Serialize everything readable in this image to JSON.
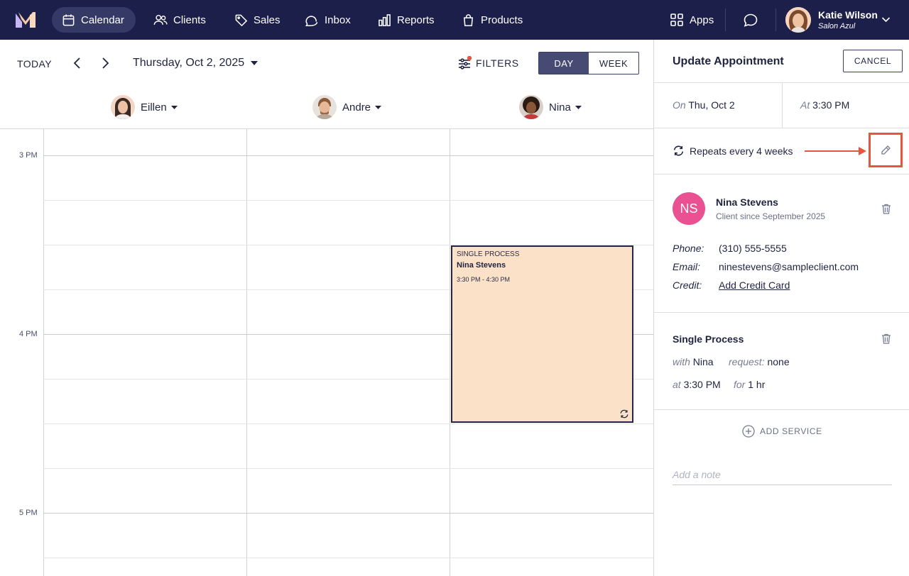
{
  "nav": {
    "items": [
      {
        "label": "Calendar",
        "icon": "calendar-icon",
        "active": true
      },
      {
        "label": "Clients",
        "icon": "clients-icon",
        "active": false
      },
      {
        "label": "Sales",
        "icon": "tag-icon",
        "active": false
      },
      {
        "label": "Inbox",
        "icon": "inbox-icon",
        "active": false
      },
      {
        "label": "Reports",
        "icon": "reports-icon",
        "active": false
      },
      {
        "label": "Products",
        "icon": "bag-icon",
        "active": false
      }
    ],
    "apps_label": "Apps",
    "user": {
      "name": "Katie Wilson",
      "salon": "Salon Azul"
    }
  },
  "toolbar": {
    "today_label": "TODAY",
    "date_label": "Thursday, Oct 2, 2025",
    "filters_label": "FILTERS",
    "day_label": "DAY",
    "week_label": "WEEK",
    "view_selected": "DAY"
  },
  "staff": [
    {
      "name": "Eillen"
    },
    {
      "name": "Andre"
    },
    {
      "name": "Nina"
    }
  ],
  "time_labels": [
    "3 PM",
    "4 PM",
    "5 PM"
  ],
  "appointment": {
    "service": "SINGLE PROCESS",
    "client": "Nina Stevens",
    "time": "3:30 PM - 4:30 PM",
    "color": "#fbe1c8",
    "repeats": true
  },
  "panel": {
    "title": "Update Appointment",
    "cancel_label": "CANCEL",
    "on_label": "On",
    "on_value": "Thu, Oct 2",
    "at_label": "At",
    "at_value": "3:30 PM",
    "repeat_text": "Repeats every 4 weeks",
    "client": {
      "initials": "NS",
      "name": "Nina Stevens",
      "since": "Client since September 2025",
      "phone_label": "Phone:",
      "phone": "(310) 555-5555",
      "email_label": "Email:",
      "email": "ninestevens@sampleclient.com",
      "credit_label": "Credit:",
      "credit_link": "Add Credit Card",
      "avatar_color": "#e95192"
    },
    "service": {
      "name": "Single Process",
      "with_label": "with",
      "with_value": "Nina",
      "request_label": "request:",
      "request_value": "none",
      "at_label": "at",
      "at_value": "3:30 PM",
      "for_label": "for",
      "for_value": "1 hr"
    },
    "add_service_label": "ADD SERVICE",
    "note_placeholder": "Add a note"
  },
  "colors": {
    "nav_bg": "#1c1f4a",
    "accent_red": "#e8553f",
    "active_toggle": "#474b73"
  }
}
